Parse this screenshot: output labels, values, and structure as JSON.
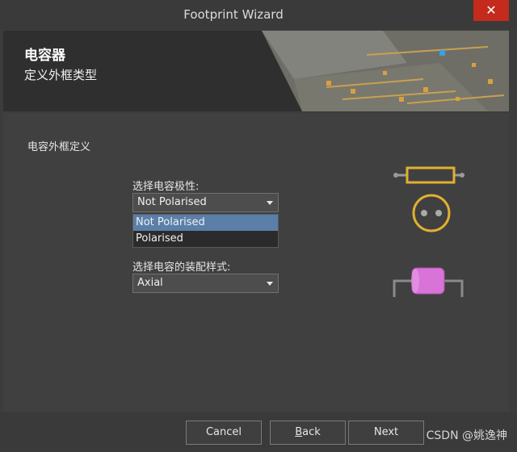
{
  "window": {
    "title": "Footprint Wizard",
    "close_glyph": "✕"
  },
  "header": {
    "title": "电容器",
    "subtitle": "定义外框类型"
  },
  "section": {
    "label": "电容外框定义"
  },
  "polarity": {
    "label": "选择电容极性:",
    "selected": "Not Polarised",
    "options": [
      "Not Polarised",
      "Polarised"
    ]
  },
  "mounting": {
    "label": "选择电容的装配样式:",
    "selected": "Axial"
  },
  "buttons": {
    "cancel": "Cancel",
    "back_prefix": "B",
    "back_rest": "ack",
    "next": "Next"
  },
  "watermark": "CSDN @姚逸神",
  "colors": {
    "accent": "#5a7fa8",
    "close": "#c42b1c",
    "outline": "#e0b030",
    "axial": "#d873d8"
  }
}
